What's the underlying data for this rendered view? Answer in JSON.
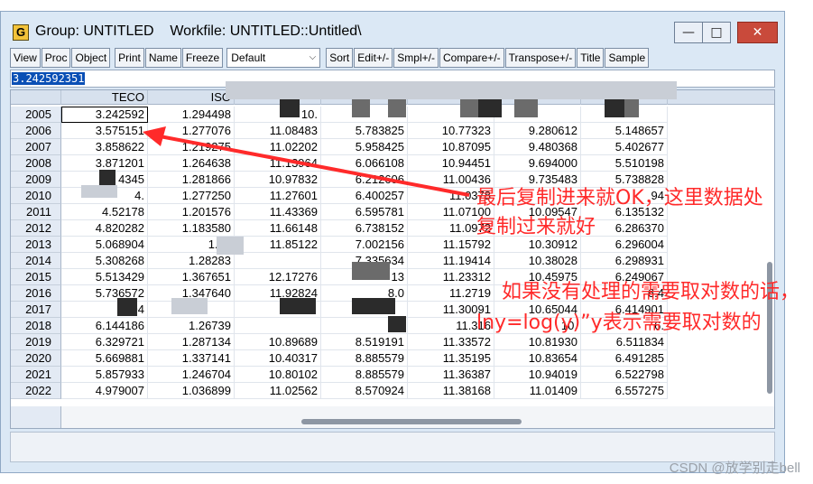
{
  "window": {
    "title": "Group: UNTITLED    Workfile: UNTITLED::Untitled\\",
    "app_icon": "G",
    "minimize": "—",
    "maximize": "□",
    "close": "✕"
  },
  "toolbar": {
    "buttons": [
      "View",
      "Proc",
      "Object",
      "Print",
      "Name",
      "Freeze"
    ],
    "dropdown_value": "Default",
    "buttons2": [
      "Sort",
      "Edit+/-",
      "Smpl+/-",
      "Compare+/-",
      "Transpose+/-",
      "Title",
      "Sample"
    ]
  },
  "edit_value": "3.242592351",
  "table": {
    "columns": [
      "TECO",
      "ISO",
      "",
      "",
      "",
      "",
      ""
    ],
    "rows": [
      {
        "year": "2005",
        "cells": [
          "3.242592",
          "1.294498",
          "10.",
          "",
          "",
          "",
          ""
        ]
      },
      {
        "year": "2006",
        "cells": [
          "3.575151",
          "1.277076",
          "11.08483",
          "5.783825",
          "10.77323",
          "9.280612",
          "5.148657"
        ]
      },
      {
        "year": "2007",
        "cells": [
          "3.858622",
          "1.219275",
          "11.02202",
          "5.958425",
          "10.87095",
          "9.480368",
          "5.402677"
        ]
      },
      {
        "year": "2008",
        "cells": [
          "3.871201",
          "1.264638",
          "11.13964",
          "6.066108",
          "10.94451",
          "9.694000",
          "5.510198"
        ]
      },
      {
        "year": "2009",
        "cells": [
          "4345",
          "1.281866",
          "10.97832",
          "6.212606",
          "11.00436",
          "9.735483",
          "5.738828"
        ]
      },
      {
        "year": "2010",
        "cells": [
          "4.",
          "1.277250",
          "11.27601",
          "6.400257",
          "11.0378",
          "",
          "94"
        ]
      },
      {
        "year": "2011",
        "cells": [
          "4.52178",
          "1.201576",
          "11.43369",
          "6.595781",
          "11.07100",
          "10.09547",
          "6.135132"
        ]
      },
      {
        "year": "2012",
        "cells": [
          "4.820282",
          "1.183580",
          "11.66148",
          "6.738152",
          "11.0972",
          "",
          "6.286370"
        ]
      },
      {
        "year": "2013",
        "cells": [
          "5.068904",
          "1.21",
          "11.85122",
          "7.002156",
          "11.15792",
          "10.30912",
          "6.296004"
        ]
      },
      {
        "year": "2014",
        "cells": [
          "5.308268",
          "1.28283",
          "",
          "7.335634",
          "11.19414",
          "10.38028",
          "6.298931"
        ]
      },
      {
        "year": "2015",
        "cells": [
          "5.513429",
          "1.367651",
          "12.17276",
          "13",
          "11.23312",
          "10.45975",
          "6.249067"
        ]
      },
      {
        "year": "2016",
        "cells": [
          "5.736572",
          "1.347640",
          "11.92824",
          "8.0",
          "11.2719",
          "",
          "6.4"
        ]
      },
      {
        "year": "2017",
        "cells": [
          "5.94",
          "",
          "",
          "",
          "11.30091",
          "10.65044",
          "6.414901"
        ]
      },
      {
        "year": "2018",
        "cells": [
          "6.144186",
          "1.26739",
          "",
          "",
          "11.316",
          "10.",
          "6."
        ]
      },
      {
        "year": "2019",
        "cells": [
          "6.329721",
          "1.287134",
          "10.89689",
          "8.519191",
          "11.33572",
          "10.81930",
          "6.511834"
        ]
      },
      {
        "year": "2020",
        "cells": [
          "5.669881",
          "1.337141",
          "10.40317",
          "8.885579",
          "11.35195",
          "10.83654",
          "6.491285"
        ]
      },
      {
        "year": "2021",
        "cells": [
          "5.857933",
          "1.246704",
          "10.80102",
          "8.885579",
          "11.36387",
          "10.94019",
          "6.522798"
        ]
      },
      {
        "year": "2022",
        "cells": [
          "4.979007",
          "1.036899",
          "11.02562",
          "8.570924",
          "11.38168",
          "11.01409",
          "6.557275"
        ]
      }
    ]
  },
  "annotations": {
    "line1": "最后复制进来就OK，这里数据处",
    "line2": "复制过来就好",
    "line3": "如果没有处理的需要取对数的话，",
    "line4": "lny=log(y)”y表示需要取对数的"
  },
  "watermark": "CSDN @放学别走bell",
  "colors": {
    "annotation": "#ff2a2a",
    "selection": "#0a4fb5",
    "window_bg": "#dbe8f5"
  }
}
